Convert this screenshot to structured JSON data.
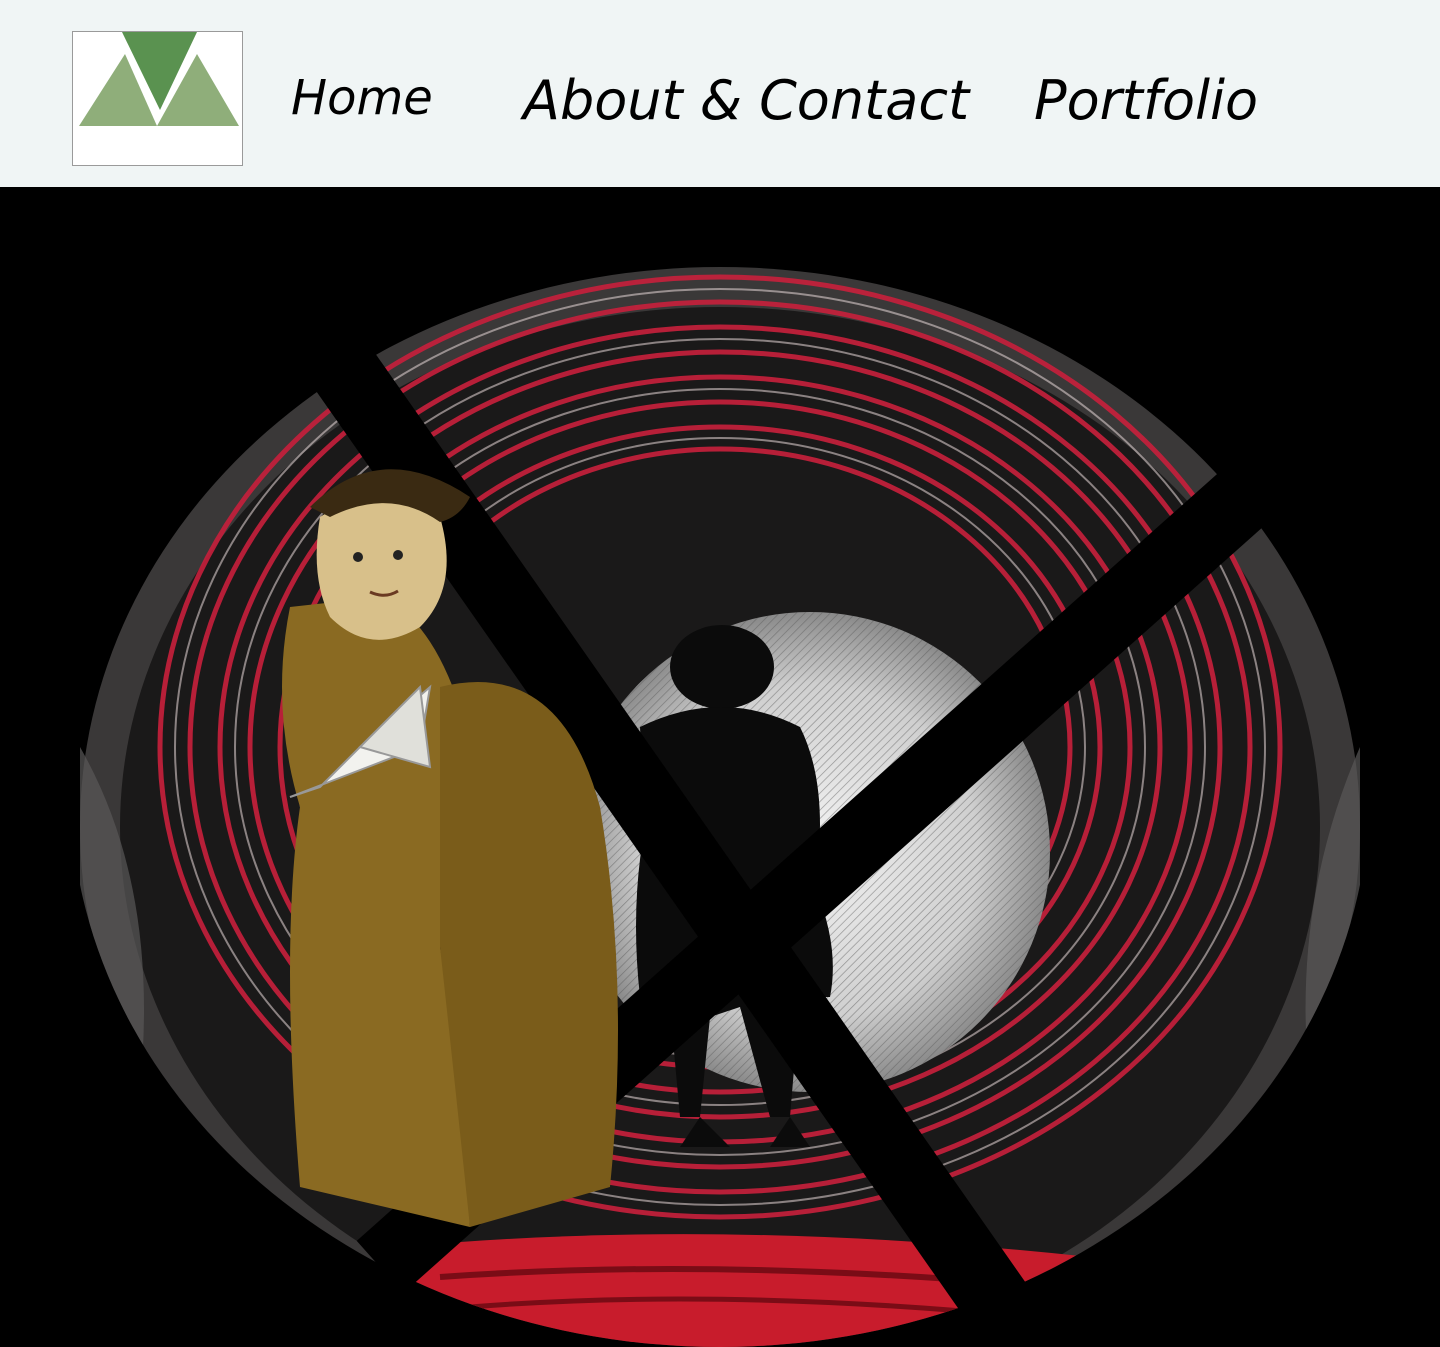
{
  "nav": {
    "home": "Home",
    "about": "About & Contact",
    "portfolio": "Portfolio"
  },
  "logo": {
    "icon": "mountain-logo-icon",
    "colors": {
      "dark": "#5a9250",
      "light": "#8fae7a"
    }
  },
  "hero": {
    "icon": "tunnel-artwork-illustration"
  },
  "colors": {
    "header_bg": "#f0f5f5",
    "hero_bg": "#000000",
    "tunnel_red": "#c8203c"
  }
}
